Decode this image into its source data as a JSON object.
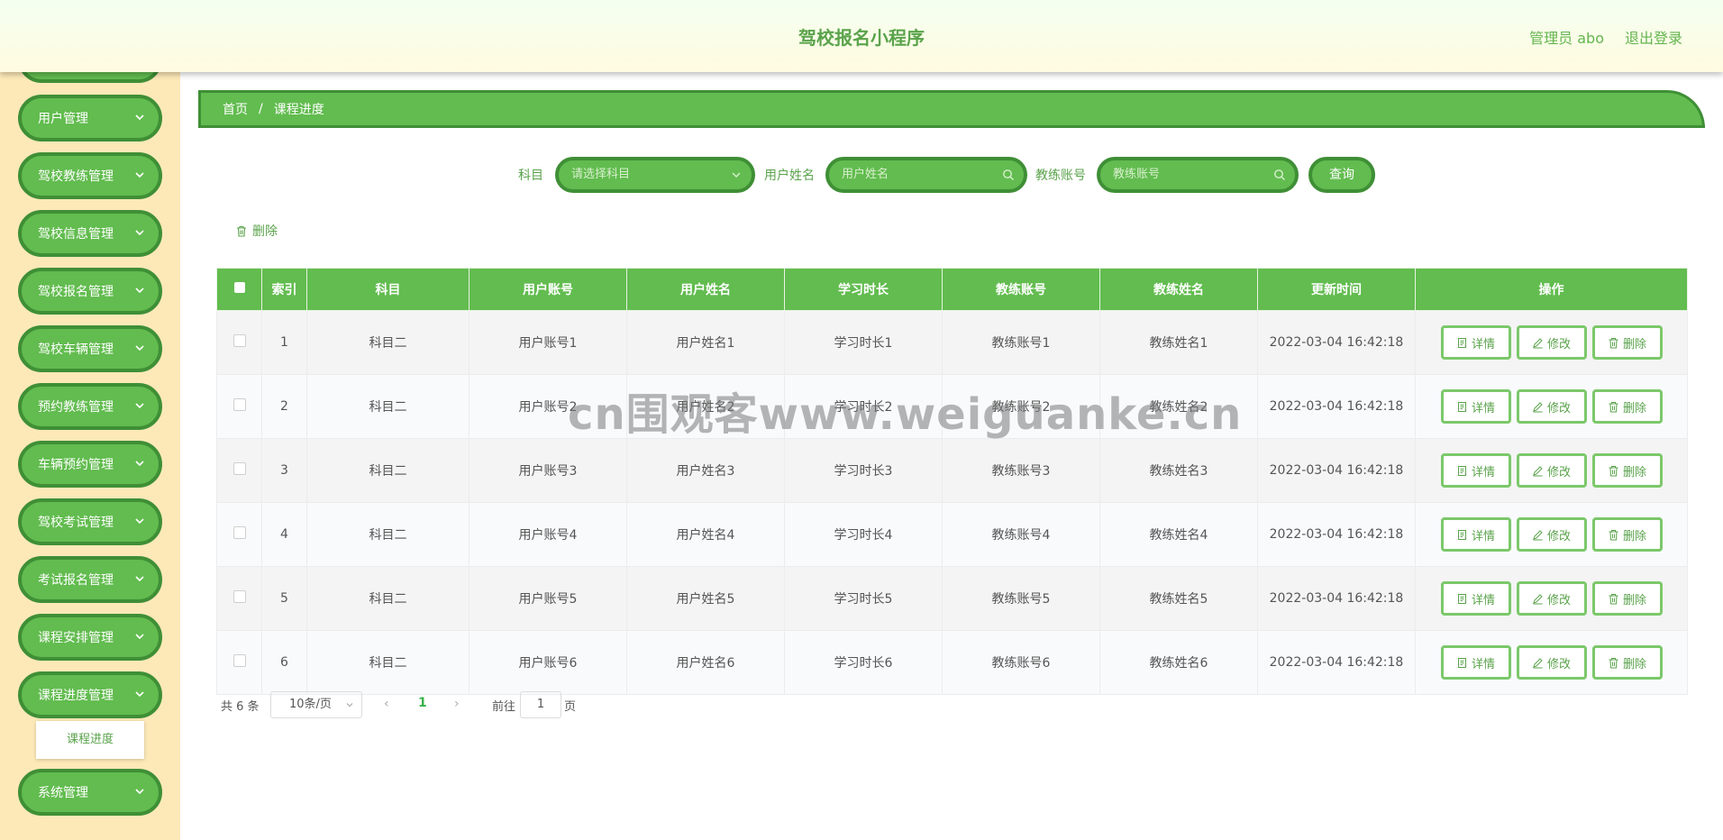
{
  "header": {
    "title": "驾校报名小程序",
    "user": "管理员 abo",
    "logout": "退出登录"
  },
  "sidebar": {
    "items": [
      {
        "label": "用户管理"
      },
      {
        "label": "驾校教练管理"
      },
      {
        "label": "驾校信息管理"
      },
      {
        "label": "驾校报名管理"
      },
      {
        "label": "驾校车辆管理"
      },
      {
        "label": "预约教练管理"
      },
      {
        "label": "车辆预约管理"
      },
      {
        "label": "驾校考试管理"
      },
      {
        "label": "考试报名管理"
      },
      {
        "label": "课程安排管理"
      },
      {
        "label": "课程进度管理"
      },
      {
        "label": "系统管理"
      }
    ],
    "submenu": {
      "label": "课程进度"
    }
  },
  "breadcrumb": {
    "home": "首页",
    "separator": "/",
    "current": "课程进度"
  },
  "search": {
    "subject_label": "科目",
    "subject_placeholder": "请选择科目",
    "username_label": "用户姓名",
    "username_placeholder": "用户姓名",
    "coach_label": "教练账号",
    "coach_placeholder": "教练账号",
    "button": "查询"
  },
  "batch_delete": "删除",
  "table": {
    "headers": [
      "索引",
      "科目",
      "用户账号",
      "用户姓名",
      "学习时长",
      "教练账号",
      "教练姓名",
      "更新时间",
      "操作"
    ],
    "rows": [
      {
        "index": "1",
        "subject": "科目二",
        "account": "用户账号1",
        "name": "用户姓名1",
        "duration": "学习时长1",
        "coach_account": "教练账号1",
        "coach_name": "教练姓名1",
        "updated": "2022-03-04 16:42:18"
      },
      {
        "index": "2",
        "subject": "科目二",
        "account": "用户账号2",
        "name": "用户姓名2",
        "duration": "学习时长2",
        "coach_account": "教练账号2",
        "coach_name": "教练姓名2",
        "updated": "2022-03-04 16:42:18"
      },
      {
        "index": "3",
        "subject": "科目二",
        "account": "用户账号3",
        "name": "用户姓名3",
        "duration": "学习时长3",
        "coach_account": "教练账号3",
        "coach_name": "教练姓名3",
        "updated": "2022-03-04 16:42:18"
      },
      {
        "index": "4",
        "subject": "科目二",
        "account": "用户账号4",
        "name": "用户姓名4",
        "duration": "学习时长4",
        "coach_account": "教练账号4",
        "coach_name": "教练姓名4",
        "updated": "2022-03-04 16:42:18"
      },
      {
        "index": "5",
        "subject": "科目二",
        "account": "用户账号5",
        "name": "用户姓名5",
        "duration": "学习时长5",
        "coach_account": "教练账号5",
        "coach_name": "教练姓名5",
        "updated": "2022-03-04 16:42:18"
      },
      {
        "index": "6",
        "subject": "科目二",
        "account": "用户账号6",
        "name": "用户姓名6",
        "duration": "学习时长6",
        "coach_account": "教练账号6",
        "coach_name": "教练姓名6",
        "updated": "2022-03-04 16:42:18"
      }
    ],
    "actions": {
      "detail": "详情",
      "edit": "修改",
      "delete": "删除"
    }
  },
  "pagination": {
    "total": "共 6 条",
    "page_size": "10条/页",
    "current_page": "1",
    "goto_label": "前往",
    "goto_value": "1",
    "page_suffix": "页"
  },
  "watermark": "cn围观客www.weiguanke.cn",
  "colors": {
    "primary": "#62bc4f",
    "border": "#3f8f36",
    "sidebar_bg": "#fde9b8",
    "text_green": "#5aa34b"
  }
}
